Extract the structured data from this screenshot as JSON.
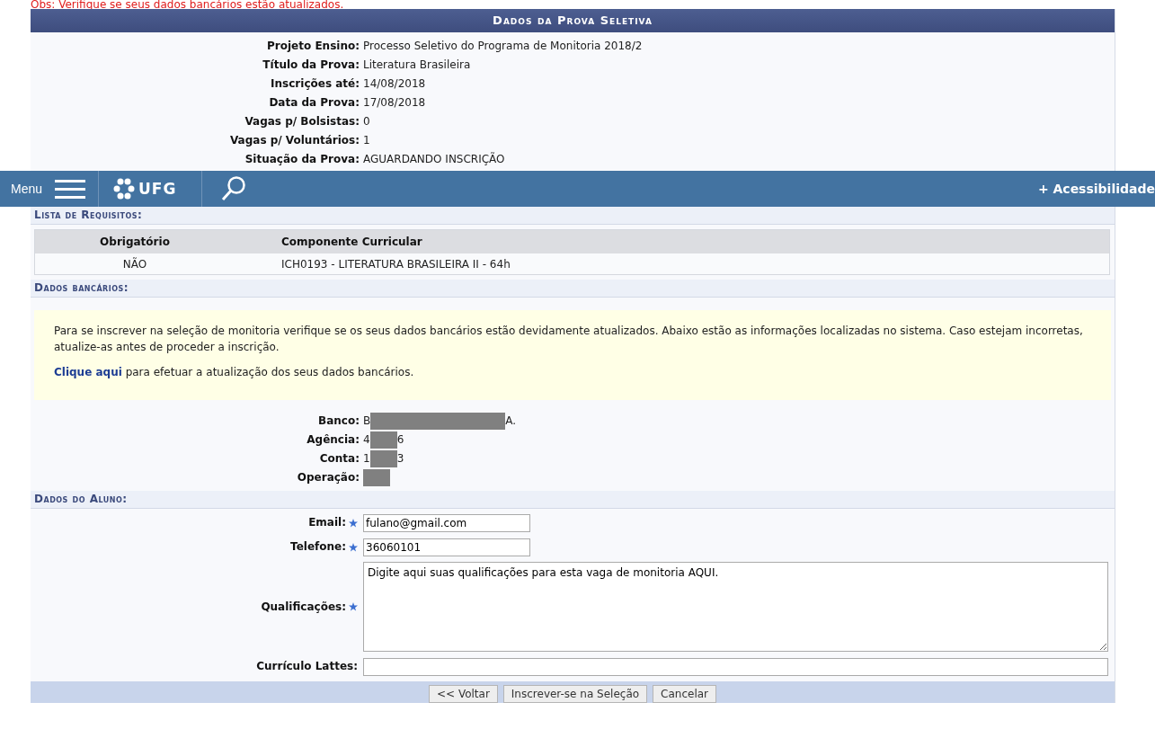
{
  "notice": "Obs: Verifique se seus dados bancários estão atualizados.",
  "exam": {
    "title": "Dados da Prova Seletiva",
    "fields": [
      {
        "label": "Projeto Ensino:",
        "value": "Processo Seletivo do Programa de Monitoria 2018/2"
      },
      {
        "label": "Título da Prova:",
        "value": "Literatura Brasileira"
      },
      {
        "label": "Inscrições até:",
        "value": "14/08/2018"
      },
      {
        "label": "Data da Prova:",
        "value": "17/08/2018"
      },
      {
        "label": "Vagas p/ Bolsistas:",
        "value": "0"
      },
      {
        "label": "Vagas p/ Voluntários:",
        "value": "1"
      },
      {
        "label": "Situação da Prova:",
        "value": "AGUARDANDO INSCRIÇÃO"
      }
    ]
  },
  "navbar": {
    "menu_label": "Menu",
    "logo_text": "UFG",
    "accessibility": "+ Acessibilidade"
  },
  "requirements": {
    "title": "Lista de Requisitos:",
    "columns": [
      "Obrigatório",
      "Componente Curricular"
    ],
    "rows": [
      [
        "NÃO",
        "ICH0193 - LITERATURA BRASILEIRA II - 64h"
      ]
    ]
  },
  "bank": {
    "title": "Dados bancários:",
    "notice": "Para se inscrever na seleção de monitoria verifique se os seus dados bancários estão devidamente atualizados. Abaixo estão as informações localizadas no sistema. Caso estejam incorretas, atualize-as antes de proceder a inscrição.",
    "link": "Clique aqui",
    "link_rest": " para efetuar a atualização dos seus dados bancários.",
    "fields": [
      {
        "label": "Banco:",
        "value_start": "B",
        "value_end": "A."
      },
      {
        "label": "Agência:",
        "value_start": "4",
        "value_end": "6"
      },
      {
        "label": "Conta:",
        "value_start": "1",
        "value_end": "3"
      },
      {
        "label": "Operação:"
      }
    ]
  },
  "student": {
    "title": "Dados do Aluno:",
    "fields": [
      {
        "kind": "input",
        "label": "Email:",
        "required": true,
        "value": "fulano@gmail.com"
      },
      {
        "kind": "input",
        "label": "Telefone:",
        "required": true,
        "value": "36060101"
      },
      {
        "kind": "textarea",
        "label": "Qualificações:",
        "required": true,
        "value": "Digite aqui suas qualificações para esta vaga de monitoria AQUI."
      },
      {
        "kind": "longinput",
        "label": "Currículo Lattes:",
        "required": false
      }
    ]
  },
  "buttons": [
    "<< Voltar",
    "Inscrever-se na Seleção",
    "Cancelar"
  ]
}
